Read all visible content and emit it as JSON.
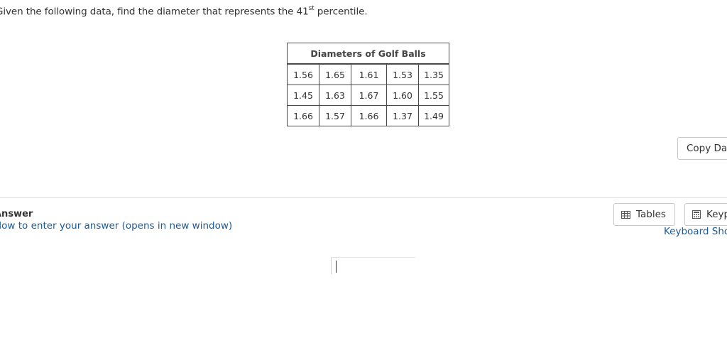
{
  "question": {
    "prefix": "Given the following data, find the diameter that represents the ",
    "ordinal_number": "41",
    "ordinal_suffix": "st",
    "suffix": " percentile."
  },
  "table": {
    "caption": "Diameters of Golf Balls",
    "rows": [
      [
        "1.56",
        "1.65",
        "1.61",
        "1.53",
        "1.35"
      ],
      [
        "1.45",
        "1.63",
        "1.67",
        "1.60",
        "1.55"
      ],
      [
        "1.66",
        "1.57",
        "1.66",
        "1.37",
        "1.49"
      ]
    ]
  },
  "copy_button": {
    "label": "Copy Data"
  },
  "answer": {
    "title": "Answer",
    "how_to_link": "How to enter your answer (opens in new window)",
    "value": ""
  },
  "tools": {
    "tables_label": "Tables",
    "tables_icon": "table-grid-icon",
    "keypad_label": "Keypad",
    "keypad_icon": "calculator-icon",
    "shortcuts_link": "Keyboard Shortcuts"
  },
  "colors": {
    "link": "#1a5a96",
    "text": "#333333",
    "border": "#4a4a4a"
  }
}
